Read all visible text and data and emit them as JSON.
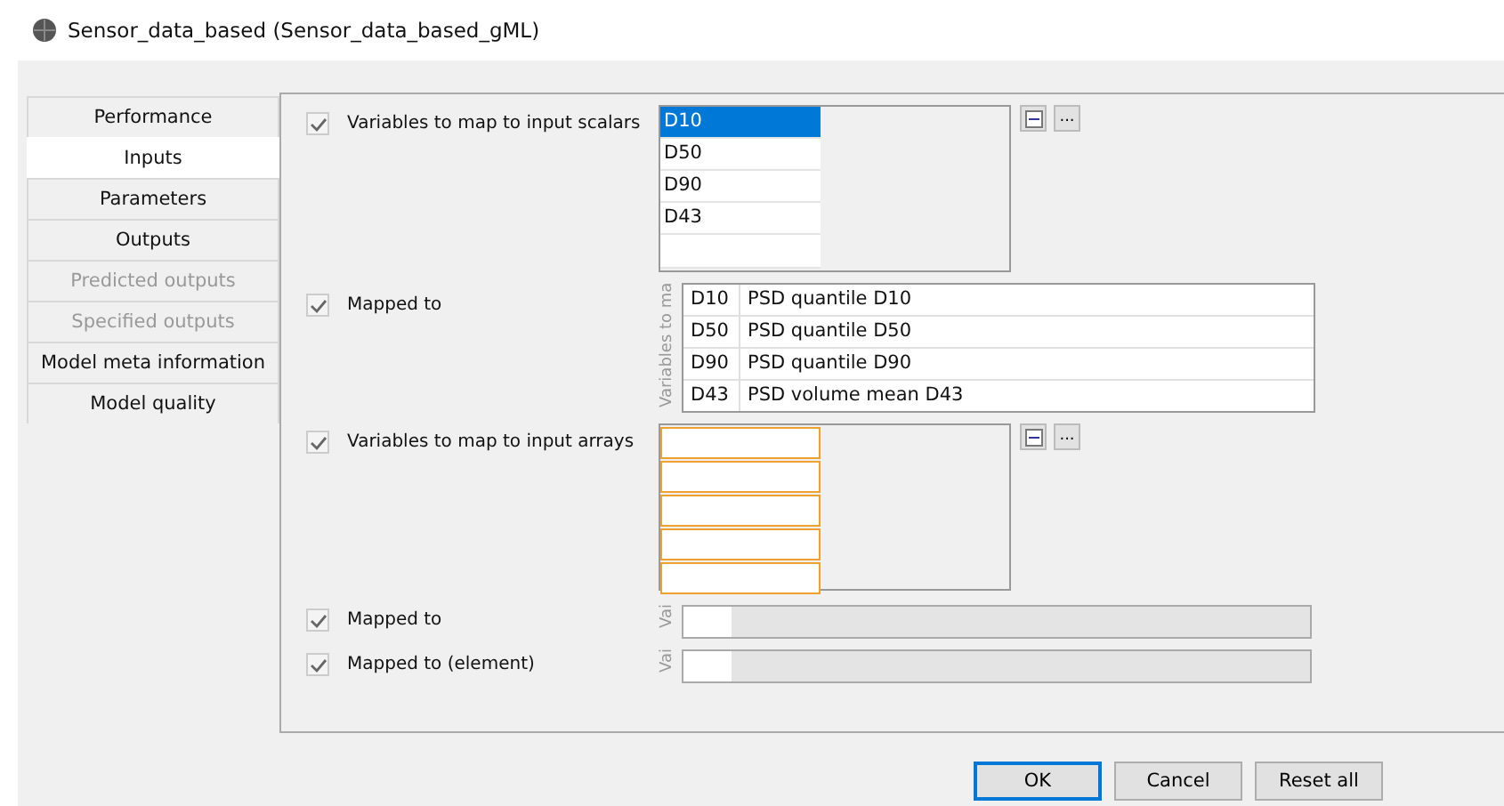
{
  "window": {
    "title": "Sensor_data_based (Sensor_data_based_gML)"
  },
  "tabs": [
    {
      "label": "Performance",
      "selected": false,
      "disabled": false
    },
    {
      "label": "Inputs",
      "selected": true,
      "disabled": false
    },
    {
      "label": "Parameters",
      "selected": false,
      "disabled": false
    },
    {
      "label": "Outputs",
      "selected": false,
      "disabled": false
    },
    {
      "label": "Predicted outputs",
      "selected": false,
      "disabled": true
    },
    {
      "label": "Specified outputs",
      "selected": false,
      "disabled": true
    },
    {
      "label": "Model meta information",
      "selected": false,
      "disabled": false
    },
    {
      "label": "Model quality",
      "selected": false,
      "disabled": false
    }
  ],
  "fields": [
    {
      "kind": "list",
      "label": "Variables to map to input scalars",
      "checked": true,
      "items": [
        {
          "text": "D10",
          "selected": true
        },
        {
          "text": "D50",
          "selected": false
        },
        {
          "text": "D90",
          "selected": false
        },
        {
          "text": "D43",
          "selected": false
        }
      ],
      "buttons": [
        "..."
      ]
    },
    {
      "kind": "table",
      "label": "Mapped to",
      "checked": true,
      "header": "Variables to ma",
      "rows": [
        [
          "D10",
          "PSD quantile D10"
        ],
        [
          "D50",
          "PSD quantile D50"
        ],
        [
          "D90",
          "PSD quantile D90"
        ],
        [
          "D43",
          "PSD volume mean D43"
        ]
      ]
    },
    {
      "kind": "slots",
      "label": "Variables to map to input arrays",
      "checked": true,
      "buttons": [
        "..."
      ]
    },
    {
      "kind": "bar",
      "label": "Mapped to",
      "checked": true,
      "header": "Vai"
    },
    {
      "kind": "bar",
      "label": "Mapped to (element)",
      "checked": true,
      "header": "Vai"
    }
  ],
  "buttons": [
    {
      "label": "OK",
      "default": true
    },
    {
      "label": "Cancel",
      "default": false
    },
    {
      "label": "Reset all",
      "default": false
    }
  ]
}
